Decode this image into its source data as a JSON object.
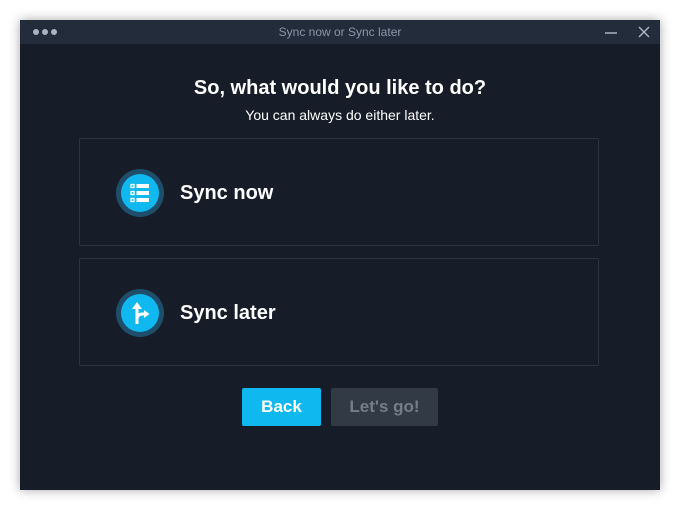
{
  "window": {
    "title": "Sync now or Sync later"
  },
  "main": {
    "heading": "So, what would you like to do?",
    "subheading": "You can always do either later."
  },
  "options": [
    {
      "label": "Sync now",
      "icon": "list-icon"
    },
    {
      "label": "Sync later",
      "icon": "fork-arrow-icon"
    }
  ],
  "buttons": {
    "back_label": "Back",
    "go_label": "Let's go!"
  },
  "colors": {
    "background": "#161c28",
    "titlebar": "#232c3b",
    "accent": "#0fb9ef",
    "disabled_button": "#323a46"
  }
}
